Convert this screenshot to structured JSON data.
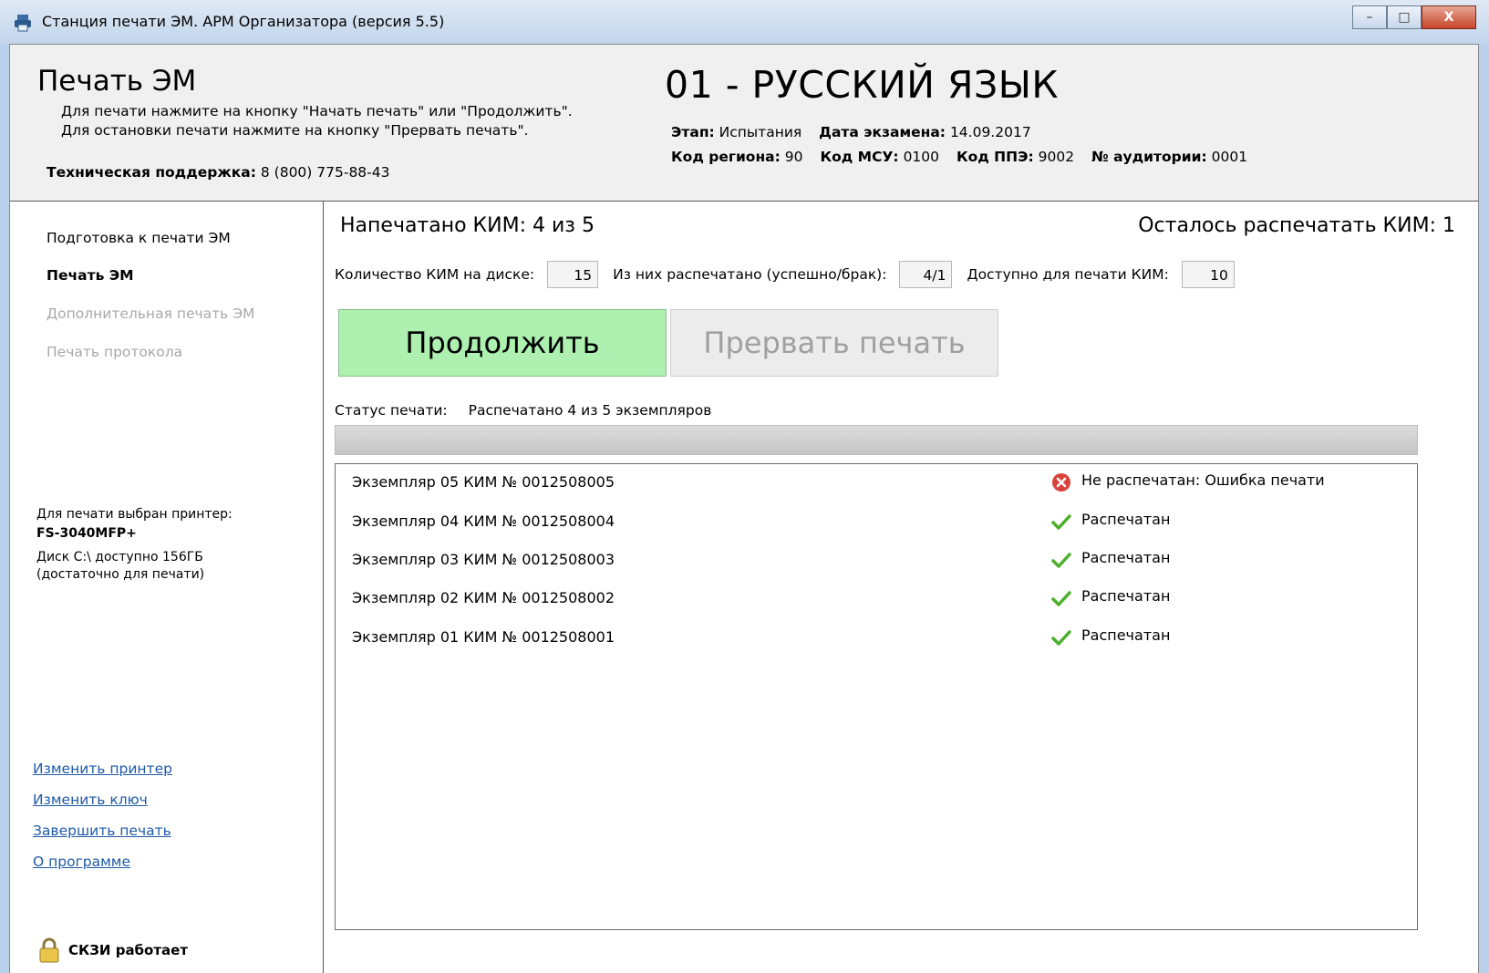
{
  "window": {
    "title": "Станция печати ЭМ. АРМ Организатора (версия 5.5)",
    "controls": {
      "minimize": "–",
      "maximize": "□",
      "close": "X"
    }
  },
  "header": {
    "title": "Печать ЭМ",
    "hint1": "Для печати нажмите на кнопку \"Начать печать\" или \"Продолжить\".",
    "hint2": "Для остановки печати нажмите на кнопку \"Прервать печать\".",
    "support_label": "Техническая поддержка:",
    "support_phone": "8 (800) 775-88-43",
    "subject": "01 - РУССКИЙ ЯЗЫК",
    "stage_label": "Этап:",
    "stage_value": "Испытания",
    "exam_date_label": "Дата экзамена:",
    "exam_date_value": "14.09.2017",
    "region_label": "Код региона:",
    "region_value": "90",
    "msu_label": "Код МСУ:",
    "msu_value": "0100",
    "ppe_label": "Код ППЭ:",
    "ppe_value": "9002",
    "room_label": "№ аудитории:",
    "room_value": "0001"
  },
  "sidebar": {
    "items": [
      {
        "label": "Подготовка к печати ЭМ",
        "state": "normal"
      },
      {
        "label": "Печать ЭМ",
        "state": "active"
      },
      {
        "label": "Дополнительная печать ЭМ",
        "state": "disabled"
      },
      {
        "label": "Печать протокола",
        "state": "disabled"
      }
    ],
    "printer_label": "Для печати выбран принтер:",
    "printer_name": "FS-3040MFP+",
    "disk_info": "Диск C:\\ доступно 156ГБ (достаточно для печати)",
    "links": [
      "Изменить принтер",
      "Изменить ключ",
      "Завершить печать",
      "О программе"
    ],
    "crypto_status": "СКЗИ работает"
  },
  "main": {
    "printed_text": "Напечатано КИМ:  4  из  5",
    "remaining_text": "Осталось распечатать КИМ:  1",
    "disk_count_label": "Количество КИМ на диске:",
    "disk_count_value": "15",
    "printed_ratio_label": "Из них распечатано (успешно/брак):",
    "printed_ratio_value": "4/1",
    "available_label": "Доступно для печати КИМ:",
    "available_value": "10",
    "continue_button": "Продолжить",
    "abort_button": "Прервать печать",
    "status_label": "Статус печати:",
    "status_value": "Распечатано 4 из 5 экземпляров",
    "progress": 1.0,
    "copies": [
      {
        "label": "Экземпляр 05  КИМ № 0012508005",
        "status": "Не распечатан: Ошибка печати",
        "icon": "error-icon"
      },
      {
        "label": "Экземпляр 04  КИМ № 0012508004",
        "status": "Распечатан",
        "icon": "check-icon"
      },
      {
        "label": "Экземпляр 03  КИМ № 0012508003",
        "status": "Распечатан",
        "icon": "check-icon"
      },
      {
        "label": "Экземпляр 02  КИМ № 0012508002",
        "status": "Распечатан",
        "icon": "check-icon"
      },
      {
        "label": "Экземпляр 01  КИМ № 0012508001",
        "status": "Распечатан",
        "icon": "check-icon"
      }
    ]
  },
  "colors": {
    "continue_bg": "#aef0b0",
    "link": "#1f5aa8",
    "error": "#d9433b",
    "check": "#4caf2c"
  }
}
